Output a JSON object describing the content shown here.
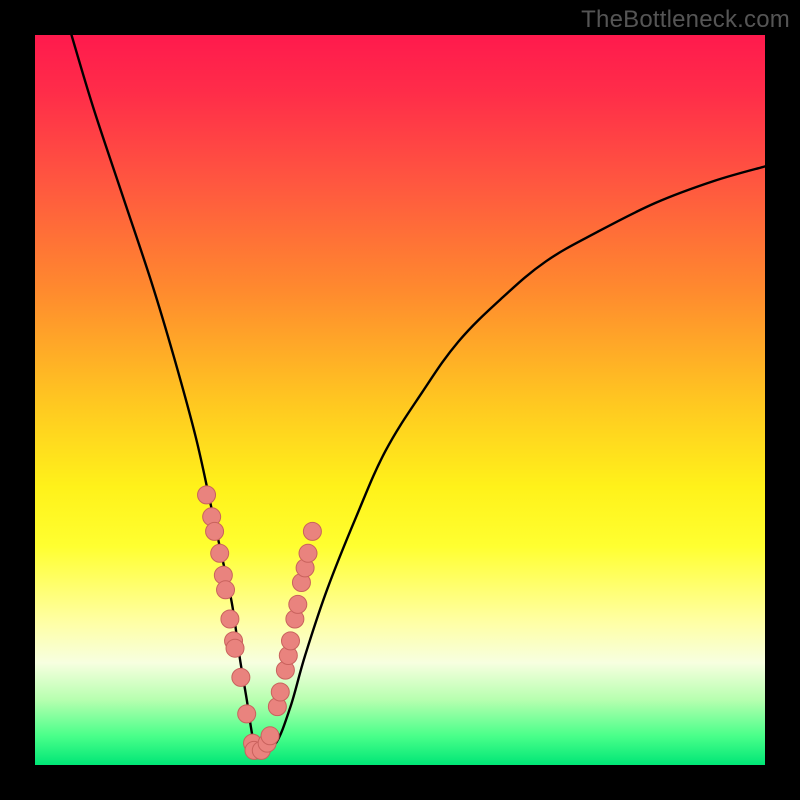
{
  "watermark": "TheBottleneck.com",
  "colors": {
    "frame": "#000000",
    "gradient_stops": [
      {
        "offset": 0.0,
        "color": "#ff1a4d"
      },
      {
        "offset": 0.08,
        "color": "#ff2d49"
      },
      {
        "offset": 0.2,
        "color": "#ff5640"
      },
      {
        "offset": 0.35,
        "color": "#ff8a2e"
      },
      {
        "offset": 0.5,
        "color": "#ffc621"
      },
      {
        "offset": 0.62,
        "color": "#fff21a"
      },
      {
        "offset": 0.7,
        "color": "#ffff30"
      },
      {
        "offset": 0.8,
        "color": "#ffffa0"
      },
      {
        "offset": 0.86,
        "color": "#f7ffe0"
      },
      {
        "offset": 0.91,
        "color": "#b8ffb0"
      },
      {
        "offset": 0.96,
        "color": "#4aff8a"
      },
      {
        "offset": 1.0,
        "color": "#00e676"
      }
    ],
    "curve": "#000000",
    "marker_fill": "#e9837e",
    "marker_stroke": "#c9625d"
  },
  "chart_data": {
    "type": "line",
    "title": "",
    "xlabel": "",
    "ylabel": "",
    "xlim": [
      0,
      100
    ],
    "ylim": [
      0,
      100
    ],
    "series": [
      {
        "name": "bottleneck-curve",
        "x": [
          5,
          8,
          12,
          16,
          19,
          22,
          24,
          25.5,
          27,
          28,
          29,
          30,
          31,
          33,
          35,
          37,
          40,
          44,
          48,
          53,
          58,
          64,
          70,
          77,
          85,
          93,
          100
        ],
        "y": [
          100,
          90,
          78,
          66,
          56,
          45,
          36,
          29,
          22,
          15,
          9,
          3,
          2,
          3,
          8,
          15,
          24,
          34,
          43,
          51,
          58,
          64,
          69,
          73,
          77,
          80,
          82
        ]
      }
    ],
    "markers": {
      "name": "highlight-points",
      "x": [
        23.5,
        24.2,
        24.6,
        25.3,
        25.8,
        26.1,
        26.7,
        27.2,
        27.4,
        28.2,
        29.0,
        29.8,
        30.0,
        31.0,
        31.8,
        32.2,
        33.2,
        33.6,
        34.3,
        34.7,
        35.0,
        35.6,
        36.0,
        36.5,
        37.0,
        37.4,
        38.0
      ],
      "y": [
        37,
        34,
        32,
        29,
        26,
        24,
        20,
        17,
        16,
        12,
        7,
        3,
        2,
        2,
        3,
        4,
        8,
        10,
        13,
        15,
        17,
        20,
        22,
        25,
        27,
        29,
        32
      ]
    }
  }
}
